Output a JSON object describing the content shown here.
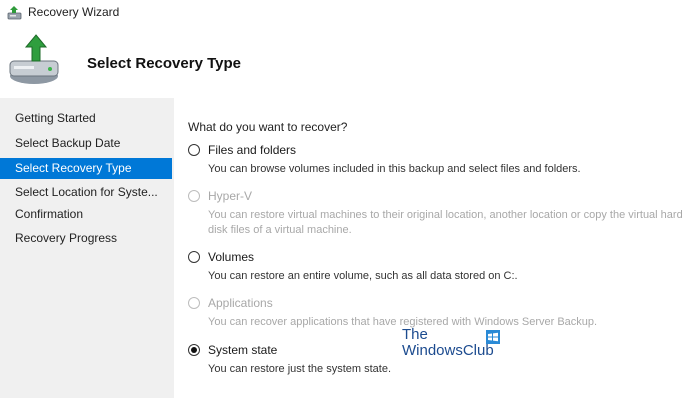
{
  "window": {
    "title": "Recovery Wizard"
  },
  "header": {
    "title": "Select Recovery Type"
  },
  "sidebar": {
    "items": [
      {
        "label": "Getting Started"
      },
      {
        "label": "Select Backup Date"
      },
      {
        "label": "Select Recovery Type",
        "selected": true
      },
      {
        "label": "Select Location for Syste..."
      },
      {
        "label": "Confirmation"
      },
      {
        "label": "Recovery Progress"
      }
    ]
  },
  "main": {
    "question": "What do you want to recover?",
    "options": [
      {
        "label": "Files and folders",
        "description": "You can browse volumes included in this backup and select files and folders.",
        "enabled": true,
        "checked": false
      },
      {
        "label": "Hyper-V",
        "description": "You can restore virtual machines to their original location, another location or copy the virtual hard disk files of a virtual machine.",
        "enabled": false,
        "checked": false
      },
      {
        "label": "Volumes",
        "description": "You can restore an entire volume, such as all data stored on C:.",
        "enabled": true,
        "checked": false
      },
      {
        "label": "Applications",
        "description": "You can recover applications that have registered with Windows Server Backup.",
        "enabled": false,
        "checked": false
      },
      {
        "label": "System state",
        "description": "You can restore just the system state.",
        "enabled": true,
        "checked": true
      }
    ]
  },
  "watermark": {
    "line1": "The",
    "line2": "WindowsClub"
  },
  "colors": {
    "accent": "#0078d7",
    "highlight": "#e6dc6a",
    "sidebar_bg": "#f0f0f0",
    "watermark": "#1c4b8f"
  }
}
